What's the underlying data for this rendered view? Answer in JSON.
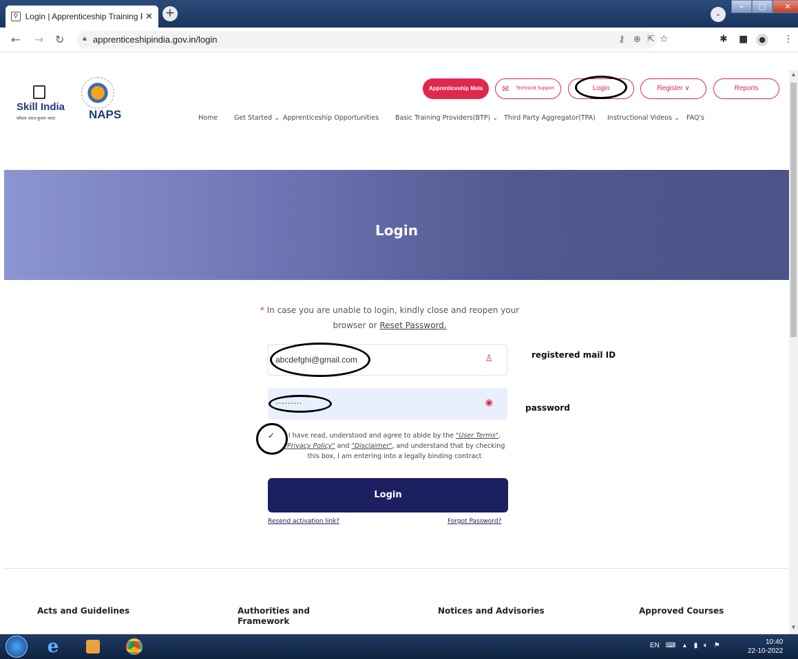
{
  "browser": {
    "tab_title": "Login | Apprenticeship Training P",
    "url": "apprenticeshipindia.gov.in/login"
  },
  "header": {
    "logo_skill": "Skill India",
    "logo_skill_sub": "कौशल भारत-कुशल भारत",
    "logo_naps": "NAPS",
    "mela_label": "Apprenticeship Mela",
    "tech_support_label": "Technical Support",
    "login_label": "Login",
    "register_label": "Register ∨",
    "reports_label": "Reports"
  },
  "nav": {
    "home": "Home",
    "get_started": "Get Started ⌄",
    "opportunities": "Apprenticeship Opportunities",
    "btp": "Basic Training Providers(BTP) ⌄",
    "tpa": "Third Party Aggregator(TPA)",
    "videos": "Instructional Videos ⌄",
    "faq": "FAQ's"
  },
  "hero": {
    "title": "Login"
  },
  "form": {
    "notice_star": "*",
    "notice_text": " In case you are unable to login, kindly close and reopen your browser or ",
    "notice_link": "Reset Password.",
    "email_value": "abcdefghi@gmail.com",
    "email_note": "registered mail ID",
    "password_value": "·········",
    "password_note": "password",
    "terms_prefix": "I have read, understood and agree to abide by the ",
    "terms_user": "\"User Terms\"",
    "terms_privacy": "\"Privacy Policy\"",
    "terms_and": " and ",
    "terms_disclaimer": "\"Disclaimer\"",
    "terms_suffix": ", and understand that by checking this box, I am entering into a legally binding contract",
    "login_button": "Login",
    "resend_link": "Resend activation link?",
    "forgot_link": "Forgot Password?"
  },
  "footer": {
    "col1": "Acts and Guidelines",
    "col2": "Authorities and Framework",
    "col3": "Notices and Advisories",
    "col4": "Approved Courses"
  },
  "taskbar": {
    "lang": "EN",
    "time": "10:40",
    "date": "22-10-2022"
  },
  "colors": {
    "accent": "#e0284f",
    "primary_navy": "#1c2060",
    "hero_start": "#8b95cf",
    "hero_end": "#4b5489"
  }
}
